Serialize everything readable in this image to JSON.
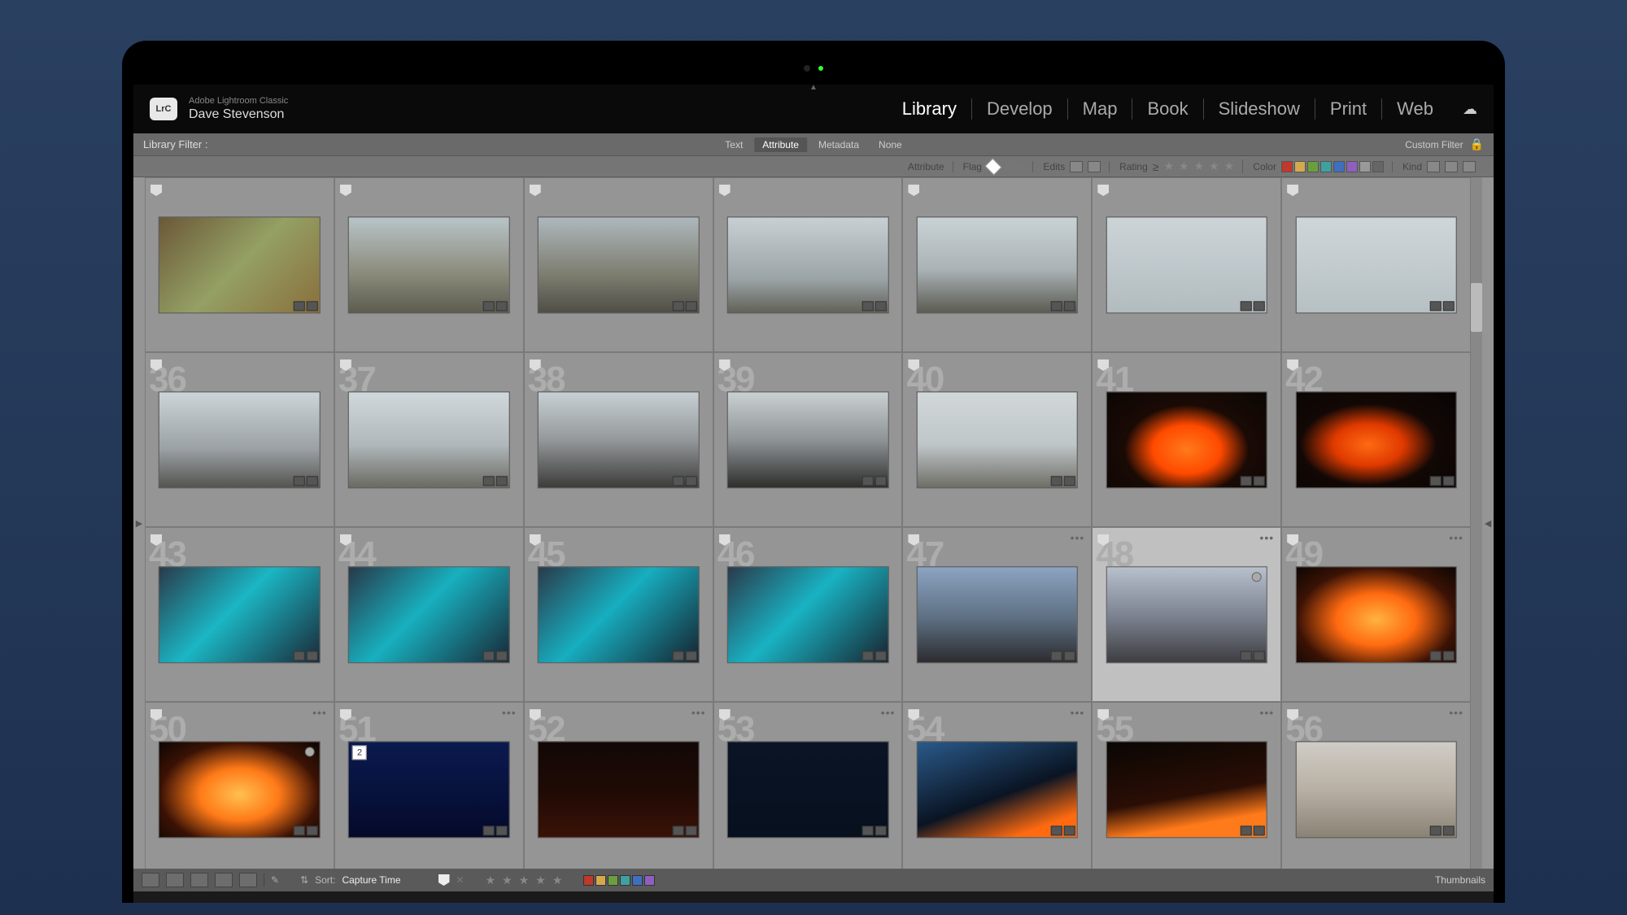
{
  "app": {
    "name": "Adobe Lightroom Classic",
    "logo": "LrC",
    "user": "Dave Stevenson"
  },
  "modules": {
    "items": [
      "Library",
      "Develop",
      "Map",
      "Book",
      "Slideshow",
      "Print",
      "Web"
    ],
    "active": "Library"
  },
  "filter_bar": {
    "label": "Library Filter :",
    "tabs": [
      "Text",
      "Attribute",
      "Metadata",
      "None"
    ],
    "active": "Attribute",
    "custom": "Custom Filter"
  },
  "attr_bar": {
    "attribute": "Attribute",
    "flag": "Flag",
    "edits": "Edits",
    "rating": "Rating",
    "rating_op": "≥",
    "color": "Color",
    "kind": "Kind"
  },
  "colors": {
    "swatches": [
      "#c0392b",
      "#d4a94e",
      "#6b9f3e",
      "#3fa0a0",
      "#3f6fbf",
      "#8f5fbf",
      "#999",
      "#666"
    ]
  },
  "grid": {
    "rows_visible_start": 36,
    "cells": [
      {
        "n": "",
        "g": "linear-gradient(135deg,#6b5838,#94a064,#8a6f3c)"
      },
      {
        "n": "",
        "g": "linear-gradient(180deg,#b8c4c8,#8a8a7a 60%,#5c5c50)"
      },
      {
        "n": "",
        "g": "linear-gradient(180deg,#aeb8bc,#7d7d70 60%,#4e4e46)"
      },
      {
        "n": "",
        "g": "linear-gradient(180deg,#c8d0d3,#9aa3a6 65%,#626258)"
      },
      {
        "n": "",
        "g": "linear-gradient(180deg,#c9d3d6,#aab2b5 55%,#5b5b52)"
      },
      {
        "n": "",
        "g": "linear-gradient(180deg,#ccd4d8,#b2bcbf)"
      },
      {
        "n": "",
        "g": "linear-gradient(180deg,#cfd6da,#b6c0c3)"
      },
      {
        "n": "36",
        "g": "linear-gradient(180deg,#cdd5d9,#9aa0a3 60%,#545450)"
      },
      {
        "n": "37",
        "g": "linear-gradient(180deg,#d0d8db,#b0b8bb 55%,#6a6a62)"
      },
      {
        "n": "38",
        "g": "linear-gradient(180deg,#c8d0d4,#94989a 50%,#3c3c3a)"
      },
      {
        "n": "39",
        "g": "linear-gradient(180deg,#cacfd2,#8f9497 50%,#2e2e2c)"
      },
      {
        "n": "40",
        "g": "linear-gradient(180deg,#d2d8da,#bfc6c8 55%,#6e6e66)"
      },
      {
        "n": "41",
        "g": "radial-gradient(ellipse at 50% 60%,#ff7a1a,#ff4a00 30%,#1a0a05 55%,#0a0604)"
      },
      {
        "n": "42",
        "g": "radial-gradient(ellipse at 45% 55%,#ff6a12,#e03a00 28%,#120805 55%,#070403)"
      },
      {
        "n": "43",
        "g": "linear-gradient(135deg,#2a3a4a,#1bb6c4 45%,#1a2a38)",
        "dots": false
      },
      {
        "n": "44",
        "g": "linear-gradient(135deg,#283848,#18b0bf 45%,#182836)",
        "dots": false
      },
      {
        "n": "45",
        "g": "linear-gradient(135deg,#2a3a4a,#17aec0 45%,#16222e)",
        "dots": false
      },
      {
        "n": "46",
        "g": "linear-gradient(135deg,#2a3a4a,#19b2c3 45%,#18242f)",
        "dots": false
      },
      {
        "n": "47",
        "g": "linear-gradient(180deg,#8ca4c2,#5c6e80 55%,#2c2c30)",
        "dots": true
      },
      {
        "n": "48",
        "g": "linear-gradient(180deg,#b8c0cc,#7d8492 50%,#3e3e42)",
        "dots": true,
        "selected": true,
        "circle": true
      },
      {
        "n": "49",
        "g": "radial-gradient(ellipse at 50% 55%,#ffb340,#ff6a10 35%,#3a1205 70%,#0c0603)",
        "dots": true
      },
      {
        "n": "50",
        "g": "radial-gradient(ellipse at 50% 55%,#ffc050,#ff7a18 35%,#3a1205 70%,#0c0603)",
        "dots": true,
        "circle": true
      },
      {
        "n": "51",
        "g": "linear-gradient(180deg,#0b1a4e,#06103a 60%,#050a2a)",
        "dots": true,
        "stack": "2"
      },
      {
        "n": "52",
        "g": "linear-gradient(180deg,#120806,#1f0a05 50%,#3a1206)",
        "dots": true
      },
      {
        "n": "53",
        "g": "linear-gradient(180deg,#0a1426,#06101e)",
        "dots": true
      },
      {
        "n": "54",
        "g": "linear-gradient(160deg,#2a5a8a,#0a1423 55%,#ff6a10 85%)",
        "dots": true
      },
      {
        "n": "55",
        "g": "linear-gradient(170deg,#0a0604,#2a0e05 55%,#ff7a1a 80%)",
        "dots": true
      },
      {
        "n": "56",
        "g": "linear-gradient(180deg,#d0ccc6,#b8b0a4 50%,#8a8274)",
        "dots": true
      }
    ]
  },
  "bottom": {
    "sort_label": "Sort:",
    "sort_value": "Capture Time",
    "thumbnails": "Thumbnails",
    "swatches": [
      "#c0392b",
      "#d4a94e",
      "#6b9f3e",
      "#3fa0a0",
      "#3f6fbf",
      "#8f5fbf"
    ]
  }
}
